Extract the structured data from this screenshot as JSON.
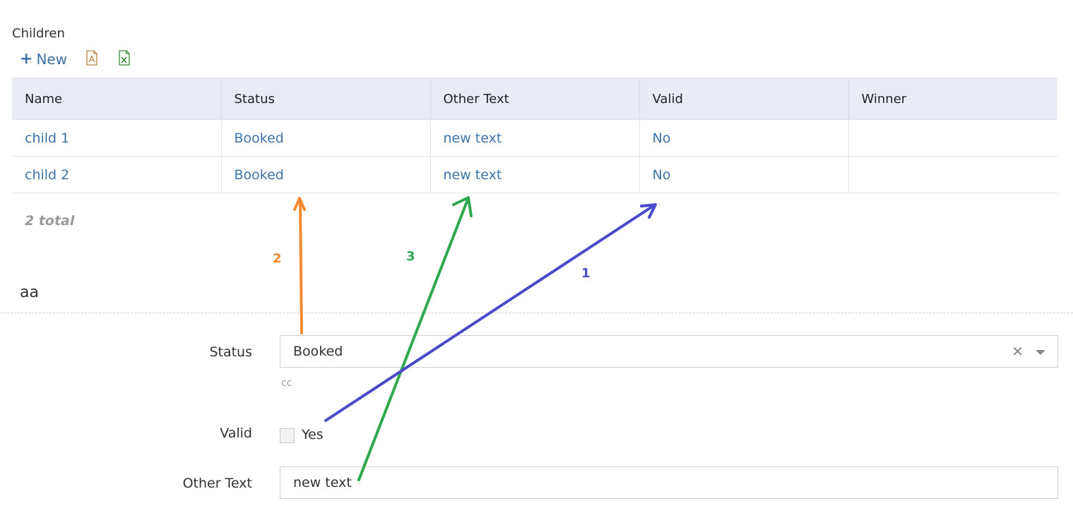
{
  "section": {
    "title": "Children"
  },
  "toolbar": {
    "new_label": "New",
    "new_icon": "plus-icon",
    "pdf_icon": "pdf-file-icon",
    "excel_icon": "excel-file-icon"
  },
  "table": {
    "columns": [
      "Name",
      "Status",
      "Other Text",
      "Valid",
      "Winner"
    ],
    "rows": [
      [
        "child 1",
        "Booked",
        "new text",
        "No",
        ""
      ],
      [
        "child 2",
        "Booked",
        "new text",
        "No",
        ""
      ]
    ],
    "total_text": "2 total"
  },
  "form": {
    "title": "aa",
    "status": {
      "label": "Status",
      "value": "Booked",
      "hint": "cc"
    },
    "valid": {
      "label": "Valid",
      "checkbox_label": "Yes",
      "checked": false
    },
    "other_text": {
      "label": "Other Text",
      "value": "new text"
    }
  },
  "annotations": {
    "arrow_1": {
      "label": "1",
      "color": "#4a4acb"
    },
    "arrow_2": {
      "label": "2",
      "color": "#f28a30"
    },
    "arrow_3": {
      "label": "3",
      "color": "#2fa84f"
    }
  },
  "colors": {
    "link": "#3e73a8",
    "header_bg": "#e9ecf5"
  }
}
